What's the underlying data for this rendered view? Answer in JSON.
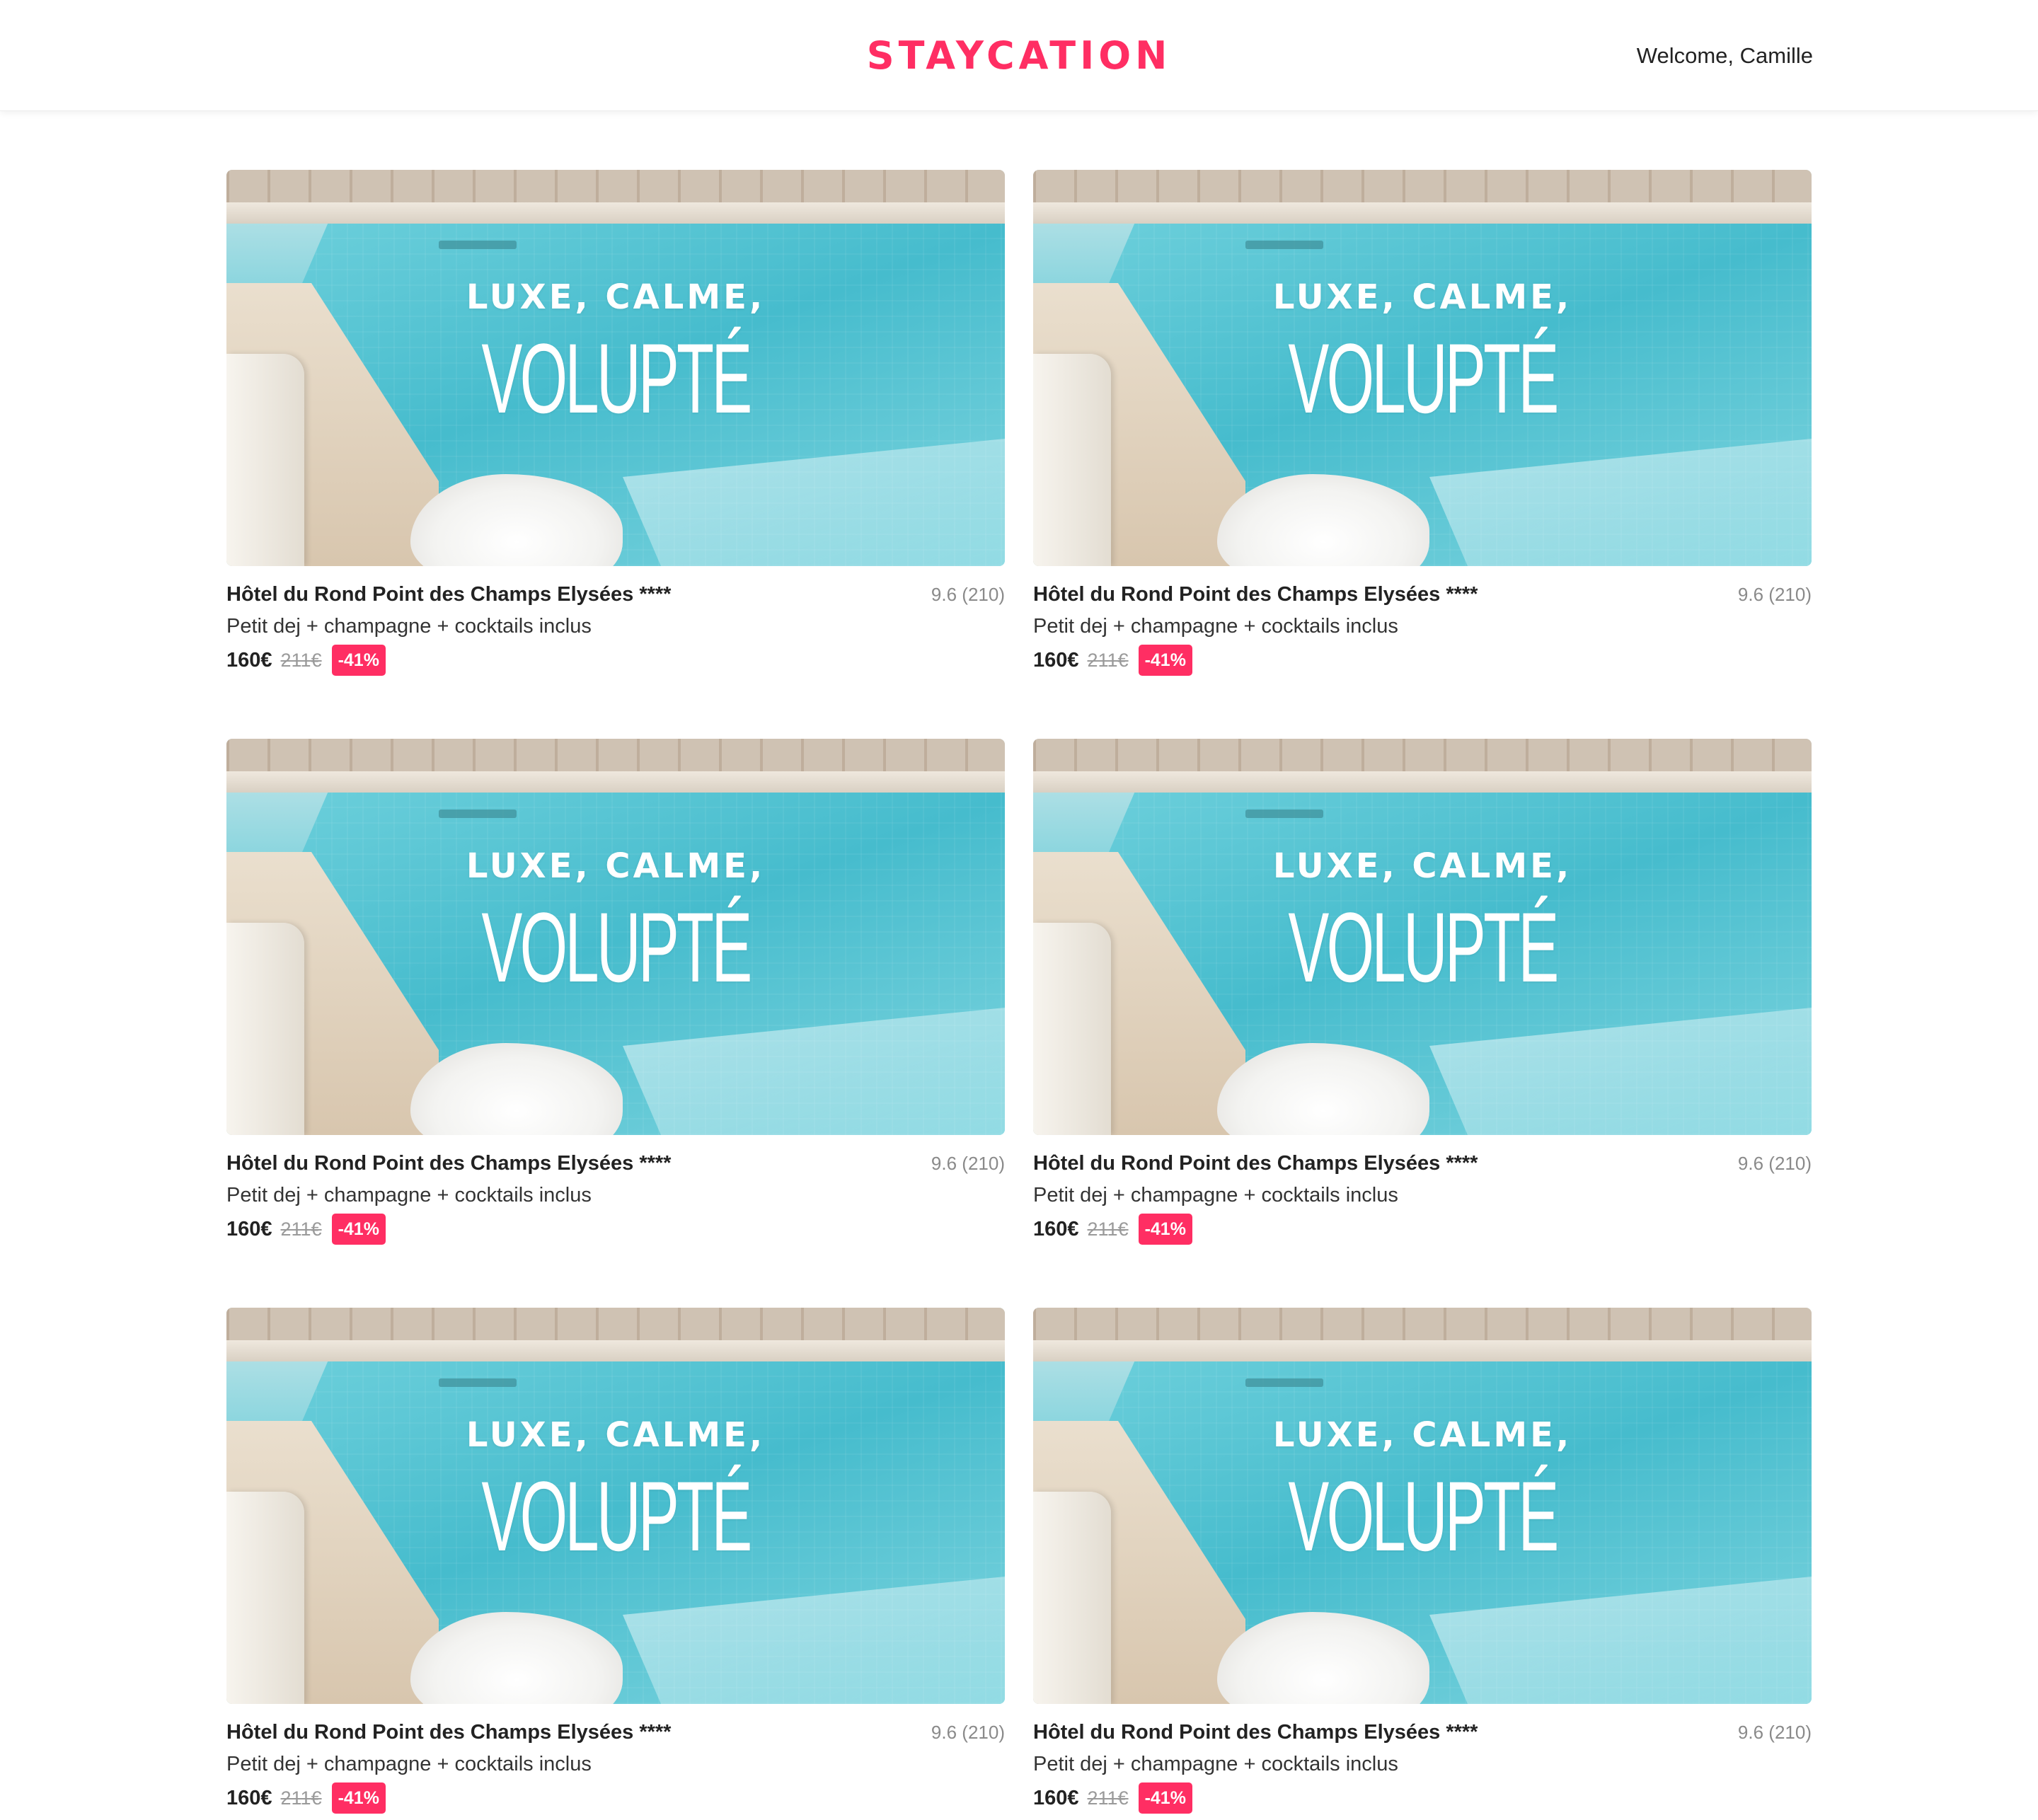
{
  "header": {
    "logo": "STAYCATION",
    "welcome": "Welcome, Camille"
  },
  "colors": {
    "brand": "#ff2e63",
    "discount_bg": "#ff2e63"
  },
  "cards": [
    {
      "image_line1": "LUXE, CALME,",
      "image_line2": "VOLUPTÉ",
      "name": "Hôtel du Rond Point des Champs Elysées ****",
      "rating": "9.6 (210)",
      "offer": "Petit dej + champagne + cocktails inclus",
      "price": "160€",
      "old_price": "211€",
      "discount": "-41%"
    },
    {
      "image_line1": "LUXE, CALME,",
      "image_line2": "VOLUPTÉ",
      "name": "Hôtel du Rond Point des Champs Elysées ****",
      "rating": "9.6 (210)",
      "offer": "Petit dej + champagne + cocktails inclus",
      "price": "160€",
      "old_price": "211€",
      "discount": "-41%"
    },
    {
      "image_line1": "LUXE, CALME,",
      "image_line2": "VOLUPTÉ",
      "name": "Hôtel du Rond Point des Champs Elysées ****",
      "rating": "9.6 (210)",
      "offer": "Petit dej + champagne + cocktails inclus",
      "price": "160€",
      "old_price": "211€",
      "discount": "-41%"
    },
    {
      "image_line1": "LUXE, CALME,",
      "image_line2": "VOLUPTÉ",
      "name": "Hôtel du Rond Point des Champs Elysées ****",
      "rating": "9.6 (210)",
      "offer": "Petit dej + champagne + cocktails inclus",
      "price": "160€",
      "old_price": "211€",
      "discount": "-41%"
    },
    {
      "image_line1": "LUXE, CALME,",
      "image_line2": "VOLUPTÉ",
      "name": "Hôtel du Rond Point des Champs Elysées ****",
      "rating": "9.6 (210)",
      "offer": "Petit dej + champagne + cocktails inclus",
      "price": "160€",
      "old_price": "211€",
      "discount": "-41%"
    },
    {
      "image_line1": "LUXE, CALME,",
      "image_line2": "VOLUPTÉ",
      "name": "Hôtel du Rond Point des Champs Elysées ****",
      "rating": "9.6 (210)",
      "offer": "Petit dej + champagne + cocktails inclus",
      "price": "160€",
      "old_price": "211€",
      "discount": "-41%"
    }
  ]
}
